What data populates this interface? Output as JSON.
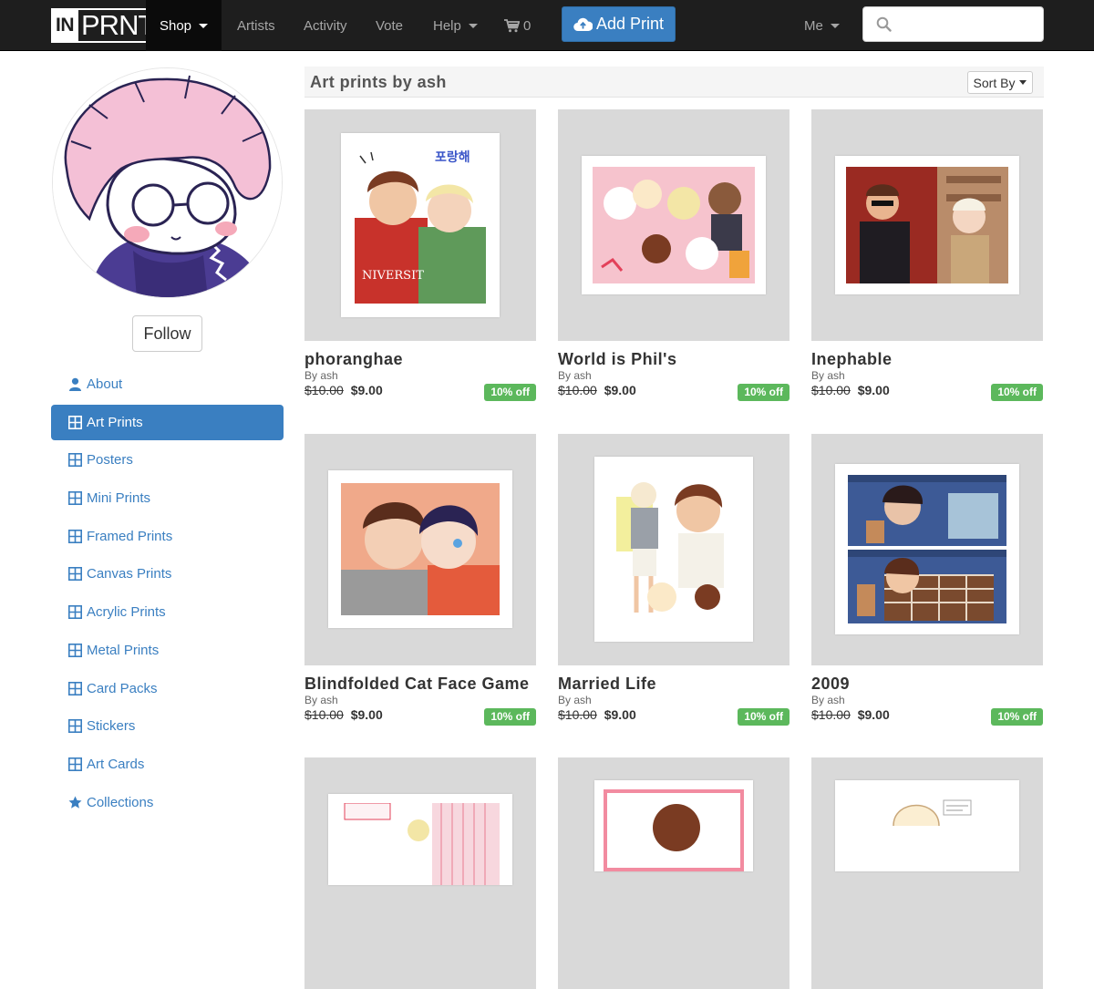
{
  "navbar": {
    "logo_in": "IN",
    "logo_prnt": "PRNT",
    "shop": "Shop",
    "artists": "Artists",
    "activity": "Activity",
    "vote": "Vote",
    "help": "Help",
    "cart_count": "0",
    "add_print": "Add Print",
    "me": "Me",
    "search_placeholder": ""
  },
  "sidebar": {
    "follow": "Follow",
    "items": [
      {
        "label": "About",
        "icon": "user-icon",
        "active": false
      },
      {
        "label": "Art Prints",
        "icon": "grid-icon",
        "active": true
      },
      {
        "label": "Posters",
        "icon": "grid-icon",
        "active": false
      },
      {
        "label": "Mini Prints",
        "icon": "grid-icon",
        "active": false
      },
      {
        "label": "Framed Prints",
        "icon": "grid-icon",
        "active": false
      },
      {
        "label": "Canvas Prints",
        "icon": "grid-icon",
        "active": false
      },
      {
        "label": "Acrylic Prints",
        "icon": "grid-icon",
        "active": false
      },
      {
        "label": "Metal Prints",
        "icon": "grid-icon",
        "active": false
      },
      {
        "label": "Card Packs",
        "icon": "grid-icon",
        "active": false
      },
      {
        "label": "Stickers",
        "icon": "grid-icon",
        "active": false
      },
      {
        "label": "Art Cards",
        "icon": "grid-icon",
        "active": false
      },
      {
        "label": "Collections",
        "icon": "star-icon",
        "active": false
      }
    ]
  },
  "main": {
    "title": "Art prints by ash",
    "sort_label": "Sort By",
    "products": [
      {
        "title": "phoranghae",
        "by": "By ash",
        "old_price": "$10.00",
        "price": "$9.00",
        "discount": "10% off"
      },
      {
        "title": "World is Phil's",
        "by": "By ash",
        "old_price": "$10.00",
        "price": "$9.00",
        "discount": "10% off"
      },
      {
        "title": "Inephable",
        "by": "By ash",
        "old_price": "$10.00",
        "price": "$9.00",
        "discount": "10% off"
      },
      {
        "title": "Blindfolded Cat Face Game",
        "by": "By ash",
        "old_price": "$10.00",
        "price": "$9.00",
        "discount": "10% off"
      },
      {
        "title": "Married Life",
        "by": "By ash",
        "old_price": "$10.00",
        "price": "$9.00",
        "discount": "10% off"
      },
      {
        "title": "2009",
        "by": "By ash",
        "old_price": "$10.00",
        "price": "$9.00",
        "discount": "10% off"
      }
    ]
  },
  "colors": {
    "navbar": "#1e1e1e",
    "accent": "#3a7fc1",
    "discount": "#5cb85c",
    "thumb_bg": "#d9d9d9"
  }
}
